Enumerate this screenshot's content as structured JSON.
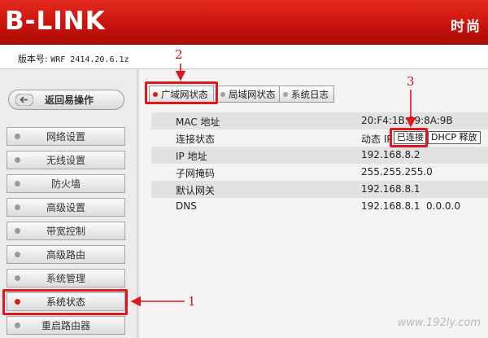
{
  "header": {
    "logo": "B-LINK",
    "slogan": "时尚"
  },
  "version": {
    "label": "版本号:",
    "value": "WRF 2414.20.6.1z"
  },
  "sidebar": {
    "back_label": "返回易操作",
    "items": [
      {
        "label": "网络设置"
      },
      {
        "label": "无线设置"
      },
      {
        "label": "防火墙"
      },
      {
        "label": "高级设置"
      },
      {
        "label": "带宽控制"
      },
      {
        "label": "高级路由"
      },
      {
        "label": "系统管理"
      },
      {
        "label": "系统状态",
        "active": true
      },
      {
        "label": "重启路由器"
      }
    ]
  },
  "tabs": [
    {
      "label": "广域网状态",
      "active": true
    },
    {
      "label": "局域网状态"
    },
    {
      "label": "系统日志"
    }
  ],
  "status": {
    "mac_label": "MAC 地址",
    "mac_value": "20:F4:1B:89:8A:9B",
    "conn_label": "连接状态",
    "conn_mode": "动态 IP",
    "conn_state": "已连接",
    "dhcp_release": "DHCP 释放",
    "ip_label": "IP 地址",
    "ip_value": "192.168.8.2",
    "mask_label": "子网掩码",
    "mask_value": "255.255.255.0",
    "gw_label": "默认网关",
    "gw_value": "192.168.8.1",
    "dns_label": "DNS",
    "dns_value1": "192.168.8.1",
    "dns_value2": "0.0.0.0"
  },
  "annotations": {
    "n1": "1",
    "n2": "2",
    "n3": "3",
    "color": "#e0161c"
  },
  "watermark": "www.192ly.com"
}
